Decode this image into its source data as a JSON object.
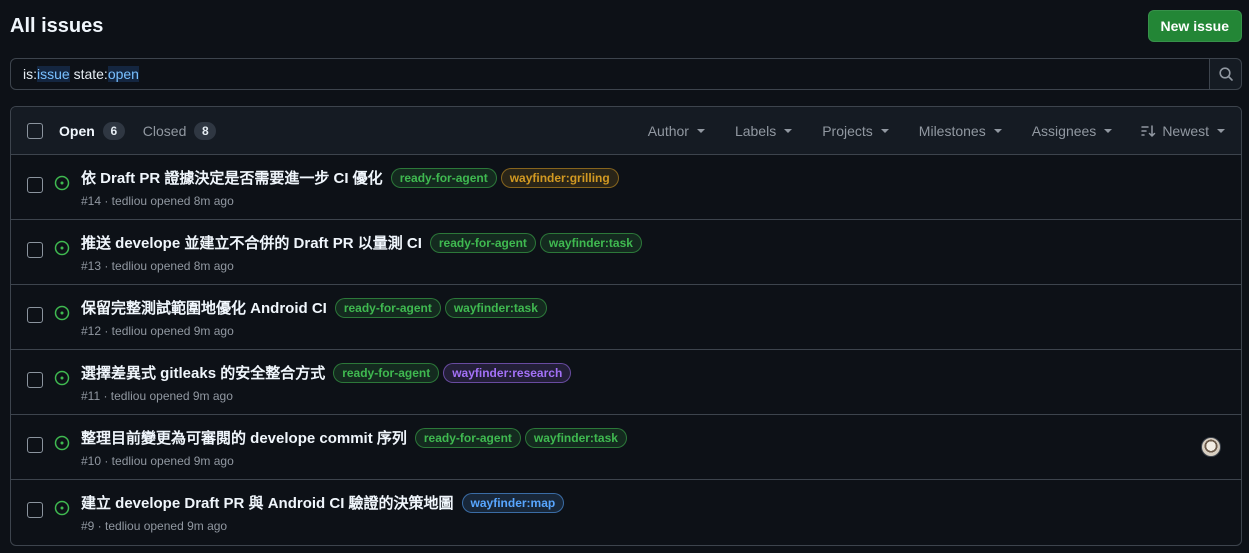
{
  "header": {
    "title": "All issues",
    "new_issue_label": "New issue"
  },
  "search": {
    "parts": [
      {
        "text": "is:",
        "kind": "key"
      },
      {
        "text": "issue",
        "kind": "value"
      },
      {
        "text": " state:",
        "kind": "key"
      },
      {
        "text": "open",
        "kind": "value"
      }
    ]
  },
  "list_header": {
    "open_label": "Open",
    "open_count": "6",
    "closed_label": "Closed",
    "closed_count": "8",
    "filters": [
      "Author",
      "Labels",
      "Projects",
      "Milestones",
      "Assignees"
    ],
    "sort_label": "Newest"
  },
  "colors": {
    "ready": "#3fb950",
    "grilling": "#d29922",
    "task": "#3fb950",
    "research": "#a371f7",
    "map": "#58a6ff"
  },
  "issues": [
    {
      "title": "依 Draft PR 證據決定是否需要進一步 CI 優化",
      "meta": "#14 · tedliou opened 8m ago",
      "labels": [
        {
          "text": "ready-for-agent",
          "color": "ready"
        },
        {
          "text": "wayfinder:grilling",
          "color": "grilling"
        }
      ],
      "has_avatar": false
    },
    {
      "title": "推送 develope 並建立不合併的 Draft PR 以量測 CI",
      "meta": "#13 · tedliou opened 8m ago",
      "labels": [
        {
          "text": "ready-for-agent",
          "color": "ready"
        },
        {
          "text": "wayfinder:task",
          "color": "task"
        }
      ],
      "has_avatar": false
    },
    {
      "title": "保留完整測試範圍地優化 Android CI",
      "meta": "#12 · tedliou opened 9m ago",
      "labels": [
        {
          "text": "ready-for-agent",
          "color": "ready"
        },
        {
          "text": "wayfinder:task",
          "color": "task"
        }
      ],
      "has_avatar": false
    },
    {
      "title": "選擇差異式 gitleaks 的安全整合方式",
      "meta": "#11 · tedliou opened 9m ago",
      "labels": [
        {
          "text": "ready-for-agent",
          "color": "ready"
        },
        {
          "text": "wayfinder:research",
          "color": "research"
        }
      ],
      "has_avatar": false
    },
    {
      "title": "整理目前變更為可審閱的 develope commit 序列",
      "meta": "#10 · tedliou opened 9m ago",
      "labels": [
        {
          "text": "ready-for-agent",
          "color": "ready"
        },
        {
          "text": "wayfinder:task",
          "color": "task"
        }
      ],
      "has_avatar": true
    },
    {
      "title": "建立 develope Draft PR 與 Android CI 驗證的決策地圖",
      "meta": "#9 · tedliou opened 9m ago",
      "labels": [
        {
          "text": "wayfinder:map",
          "color": "map"
        }
      ],
      "has_avatar": false
    }
  ]
}
